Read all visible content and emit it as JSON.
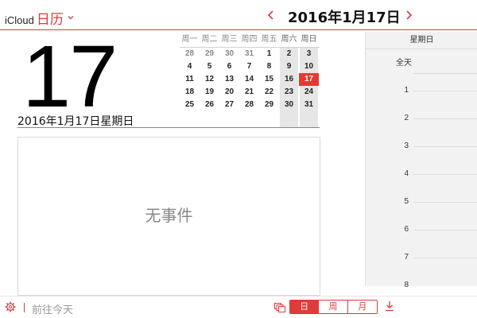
{
  "header": {
    "brand": "iCloud",
    "app_name": "日历",
    "date": "2016年1月17日",
    "accent_color": "#e03a3a"
  },
  "day_view": {
    "big_day": "17",
    "full_date": "2016年1月17日星期日",
    "empty_text": "无事件"
  },
  "mini_calendar": {
    "weekdays": [
      "周一",
      "周二",
      "周三",
      "周四",
      "周五",
      "周六",
      "周日"
    ],
    "weeks": [
      [
        "28",
        "29",
        "30",
        "31",
        "1",
        "2",
        "3"
      ],
      [
        "4",
        "5",
        "6",
        "7",
        "8",
        "9",
        "10"
      ],
      [
        "11",
        "12",
        "13",
        "14",
        "15",
        "16",
        "17"
      ],
      [
        "18",
        "19",
        "20",
        "21",
        "22",
        "23",
        "24"
      ],
      [
        "25",
        "26",
        "27",
        "28",
        "29",
        "30",
        "31"
      ]
    ],
    "selected": "17"
  },
  "timeline": {
    "day_label": "星期日",
    "all_day": "全天",
    "hours": [
      "1",
      "2",
      "3",
      "4",
      "5",
      "6",
      "7",
      "8"
    ]
  },
  "footer": {
    "today_link": "前往今天",
    "views": [
      "日",
      "周",
      "月"
    ],
    "active_view": "日"
  },
  "icons": [
    "chevron-down-icon",
    "chevron-left-icon",
    "chevron-right-icon",
    "gear-icon",
    "views-icon",
    "download-icon"
  ]
}
